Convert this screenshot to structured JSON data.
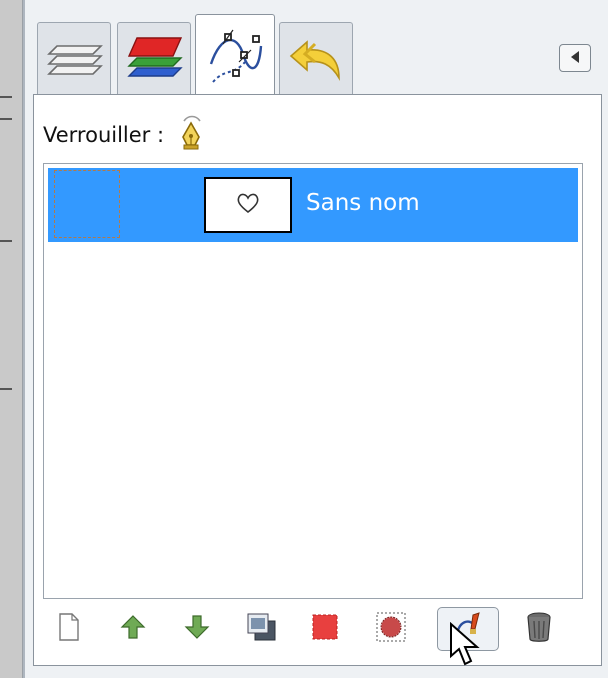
{
  "tabs": [
    {
      "id": "layers",
      "icon": "layers-icon",
      "active": false
    },
    {
      "id": "channels",
      "icon": "channels-icon",
      "active": false
    },
    {
      "id": "paths",
      "icon": "paths-icon",
      "active": true
    },
    {
      "id": "undo-history",
      "icon": "undo-history-icon",
      "active": false
    }
  ],
  "tab_menu": {
    "icon": "triangle-left-icon"
  },
  "lock": {
    "label": "Verrouiller :",
    "icon": "pen-nib-lock-icon"
  },
  "paths": [
    {
      "name": "Sans nom",
      "selected": true,
      "thumbnail_icon": "heart-outline-icon"
    }
  ],
  "toolbar": [
    {
      "name": "new-path-button",
      "icon": "new-document-icon"
    },
    {
      "name": "raise-path-button",
      "icon": "arrow-up-icon"
    },
    {
      "name": "lower-path-button",
      "icon": "arrow-down-icon"
    },
    {
      "name": "duplicate-path-button",
      "icon": "duplicate-icon"
    },
    {
      "name": "path-to-selection-button",
      "icon": "path-to-selection-icon"
    },
    {
      "name": "selection-to-path-button",
      "icon": "selection-to-path-icon"
    },
    {
      "name": "paint-along-path-button",
      "icon": "paint-path-icon",
      "pressed": true
    },
    {
      "name": "delete-path-button",
      "icon": "trash-icon"
    }
  ],
  "colors": {
    "selection": "#3399ff",
    "path_name_text": "#ffffff",
    "panel_bg": "#ffffff",
    "dock_bg": "#eef1f4"
  }
}
